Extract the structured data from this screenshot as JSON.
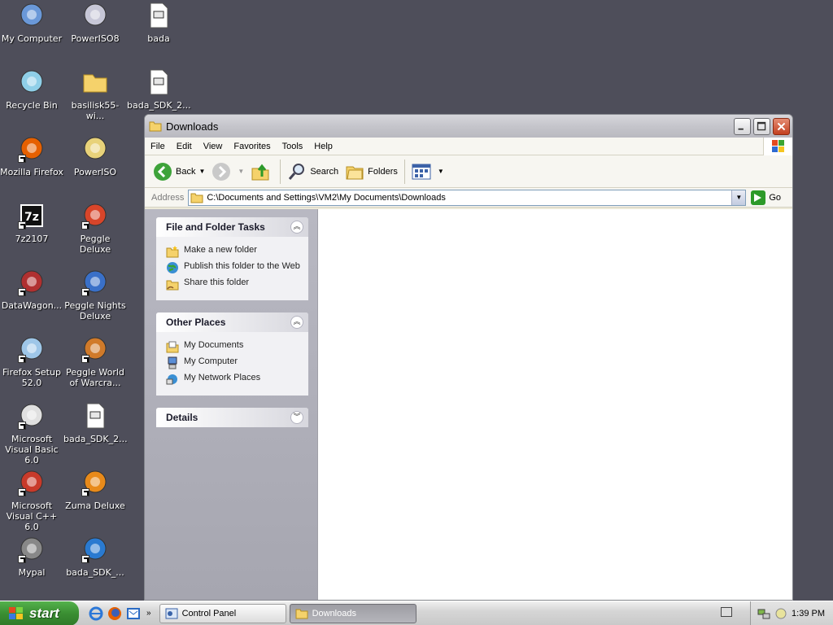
{
  "desktop": {
    "icons": [
      {
        "label": "My Computer",
        "icon": "my-computer-icon"
      },
      {
        "label": "PowerISO8",
        "icon": "poweriso-installer-icon"
      },
      {
        "label": "bada",
        "icon": "bada-file-icon"
      },
      {
        "label": "Recycle Bin",
        "icon": "recycle-bin-icon"
      },
      {
        "label": "basilisk55-wi...",
        "icon": "folder-icon"
      },
      {
        "label": "bada_SDK_2...",
        "icon": "sdk-file-icon"
      },
      {
        "label": "Mozilla Firefox",
        "icon": "firefox-icon"
      },
      {
        "label": "PowerISO",
        "icon": "poweriso-icon"
      },
      {
        "label": "7z2107",
        "icon": "7zip-icon"
      },
      {
        "label": "Peggle Deluxe",
        "icon": "peggle-icon"
      },
      {
        "label": "DataWagon...",
        "icon": "datawagon-icon"
      },
      {
        "label": "Peggle Nights Deluxe",
        "icon": "peggle-nights-icon"
      },
      {
        "label": "Firefox Setup 52.0",
        "icon": "firefox-setup-icon"
      },
      {
        "label": "Peggle World of Warcra...",
        "icon": "peggle-wow-icon"
      },
      {
        "label": "Microsoft Visual Basic 6.0",
        "icon": "vb6-icon"
      },
      {
        "label": "bada_SDK_2...",
        "icon": "sdk-file-icon"
      },
      {
        "label": "Microsoft Visual C++ 6.0",
        "icon": "vc6-icon"
      },
      {
        "label": "Zuma Deluxe",
        "icon": "zuma-icon"
      },
      {
        "label": "Mypal",
        "icon": "mypal-icon"
      },
      {
        "label": "bada_SDK_...",
        "icon": "bada-sdk-installer-icon"
      }
    ]
  },
  "window": {
    "title": "Downloads",
    "menu": [
      "File",
      "Edit",
      "View",
      "Favorites",
      "Tools",
      "Help"
    ],
    "toolbar": {
      "back": "Back",
      "search": "Search",
      "folders": "Folders"
    },
    "address": {
      "label": "Address",
      "path": "C:\\Documents and Settings\\VM2\\My Documents\\Downloads",
      "go": "Go"
    },
    "panels": {
      "file_tasks": {
        "title": "File and Folder Tasks",
        "items": [
          "Make a new folder",
          "Publish this folder to the Web",
          "Share this folder"
        ]
      },
      "other_places": {
        "title": "Other Places",
        "items": [
          "My Documents",
          "My Computer",
          "My Network Places"
        ]
      },
      "details": {
        "title": "Details"
      }
    }
  },
  "taskbar": {
    "start": "start",
    "buttons": [
      "Control Panel",
      "Downloads"
    ],
    "clock": "1:39 PM"
  },
  "colors": {
    "desktop": "#4e4e5a",
    "start_green": "#3a8e32",
    "taskpane": "#b1b1bb"
  }
}
